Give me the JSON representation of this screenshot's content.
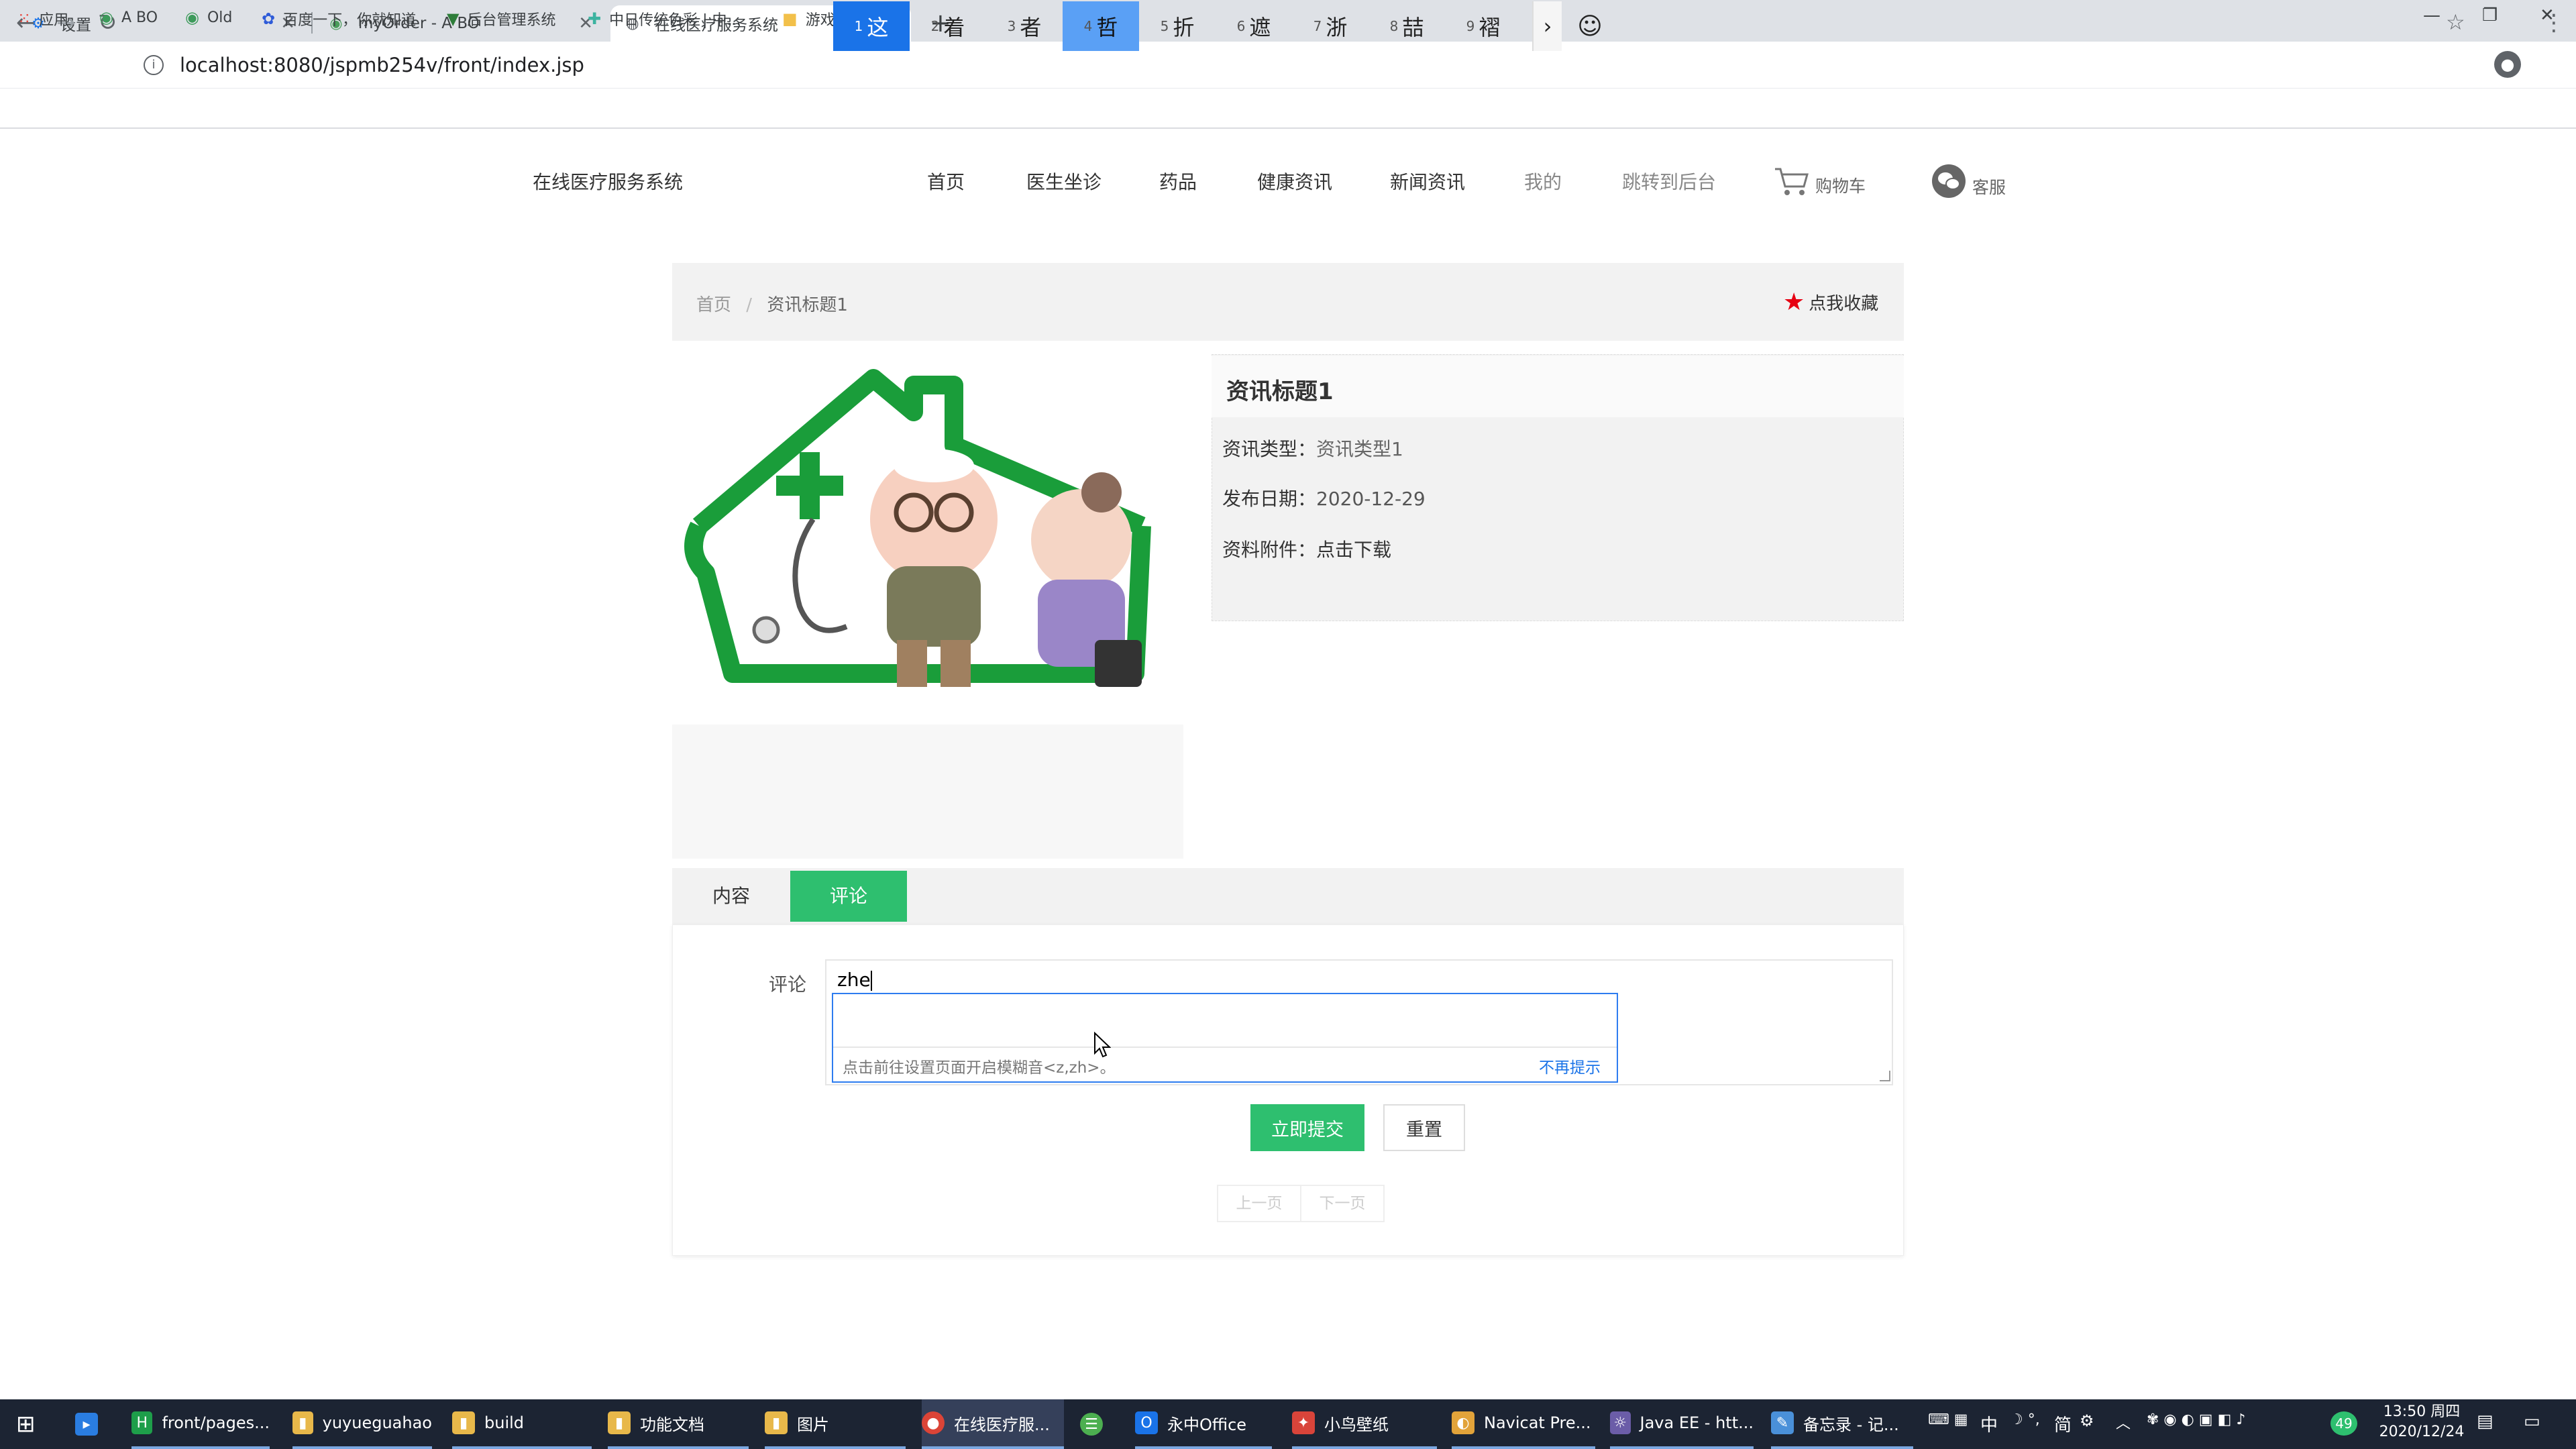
{
  "browser": {
    "tabs": [
      {
        "title": "设置",
        "icon": "gear-icon"
      },
      {
        "title": "myOrder - A BO",
        "icon": "globe-icon"
      },
      {
        "title": "在线医疗服务系统",
        "icon": "globe-icon"
      }
    ],
    "url": "localhost:8080/jspmb254v/front/index.jsp",
    "bookmarks": [
      {
        "label": "应用",
        "icon": "apps-grid-icon"
      },
      {
        "label": "A BO",
        "icon": "bookmark-icon"
      },
      {
        "label": "Old",
        "icon": "bookmark-icon"
      },
      {
        "label": "百度一下，你就知道",
        "icon": "baidu-icon"
      },
      {
        "label": "后台管理系统",
        "icon": "vue-icon"
      },
      {
        "label": "中日传统色彩 | 中...",
        "icon": "bookmark-icon"
      },
      {
        "label": "游戏",
        "icon": "folder-icon"
      }
    ]
  },
  "site": {
    "brand": "在线医疗服务系统",
    "nav": [
      "首页",
      "医生坐诊",
      "药品",
      "健康资讯",
      "新闻资讯",
      "我的",
      "跳转到后台"
    ],
    "cart": "购物车",
    "service": "客服"
  },
  "breadcrumb": {
    "home": "首页",
    "sep": "/",
    "current": "资讯标题1"
  },
  "favorite": "点我收藏",
  "article": {
    "title": "资讯标题1",
    "type_label": "资讯类型：",
    "type_value": "资讯类型1",
    "date_label": "发布日期：",
    "date_value": "2020-12-29",
    "attach_label": "资料附件：",
    "attach_value": "点击下载"
  },
  "tabs": {
    "content": "内容",
    "comment": "评论"
  },
  "comment": {
    "label": "评论",
    "value": "zhe",
    "submit": "立即提交",
    "reset": "重置",
    "prev": "上一页",
    "next": "下一页"
  },
  "ime": {
    "candidates": [
      {
        "n": "1",
        "c": "这"
      },
      {
        "n": "2",
        "c": "着"
      },
      {
        "n": "3",
        "c": "者"
      },
      {
        "n": "4",
        "c": "哲"
      },
      {
        "n": "5",
        "c": "折"
      },
      {
        "n": "6",
        "c": "遮"
      },
      {
        "n": "7",
        "c": "浙"
      },
      {
        "n": "8",
        "c": "喆"
      },
      {
        "n": "9",
        "c": "褶"
      }
    ],
    "hint": "点击前往设置页面开启模糊音<z,zh>。",
    "dismiss": "不再提示"
  },
  "taskbar": {
    "items": [
      {
        "label": "front/pages...",
        "color": "#1e9e4a",
        "glyph": "H"
      },
      {
        "label": "yuyueguahao",
        "color": "#e8b84a",
        "glyph": "▮"
      },
      {
        "label": "build",
        "color": "#e8b84a",
        "glyph": "▮"
      },
      {
        "label": "功能文档",
        "color": "#e8b84a",
        "glyph": "▮"
      },
      {
        "label": "图片",
        "color": "#e8b84a",
        "glyph": "▮"
      },
      {
        "label": "在线医疗服...",
        "color": "#db4437",
        "glyph": "●"
      },
      {
        "label": "永中Office",
        "color": "#1a73e8",
        "glyph": "O"
      },
      {
        "label": "小鸟壁纸",
        "color": "#d9443a",
        "glyph": "✦"
      },
      {
        "label": "Navicat Pre...",
        "color": "#e2a33a",
        "glyph": "◐"
      },
      {
        "label": "Java EE - htt...",
        "color": "#6b5da8",
        "glyph": "☼"
      },
      {
        "label": "备忘录 - 记...",
        "color": "#4a90d9",
        "glyph": "✎"
      }
    ],
    "tray": {
      "ime": "中",
      "lang": "简",
      "time": "13:50 周四",
      "date": "2020/12/24",
      "badge": "49"
    }
  }
}
